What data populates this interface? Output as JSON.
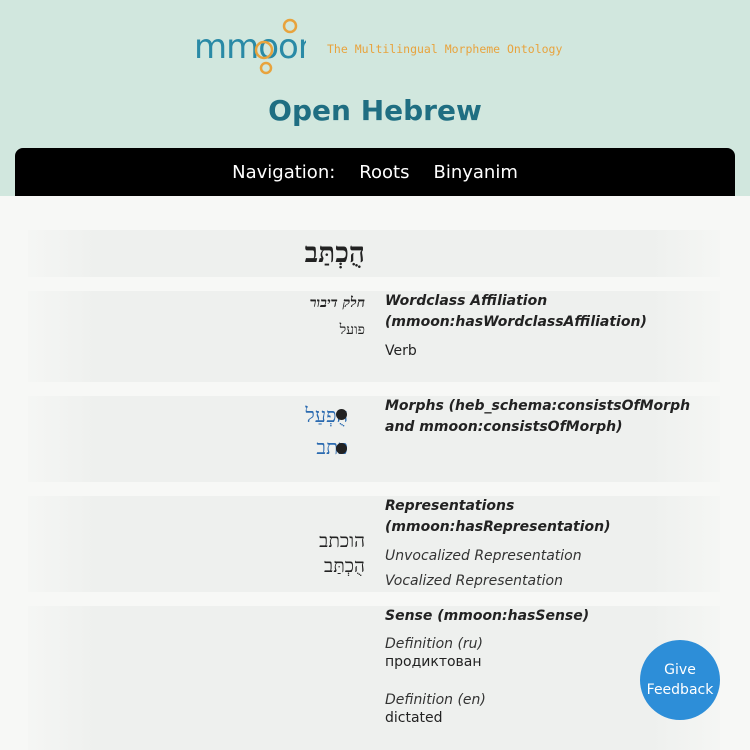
{
  "logo": {
    "text": "mmoon",
    "tagline": "The Multilingual Morpheme Ontology"
  },
  "site": {
    "title": "Open Hebrew"
  },
  "nav": {
    "label": "Navigation:",
    "items": [
      "Roots",
      "Binyanim"
    ]
  },
  "entry": {
    "headword": "הֻכְתַּב",
    "wordclass": {
      "label_he": "חלק דיבור",
      "value_he": "פועל",
      "property": "Wordclass Affiliation (mmoon:hasWordclassAffiliation)",
      "value": "Verb"
    },
    "morphs": {
      "property": "Morphs (heb_schema:consistsOfMorph and mmoon:consistsOfMorph)",
      "items": [
        "הֻפְעַל",
        "כתב"
      ]
    },
    "representations": {
      "property": "Representations (mmoon:hasRepresentation)",
      "unvocalized_label": "Unvocalized Representation",
      "vocalized_label": "Vocalized Representation",
      "unvocalized": "הוכתב",
      "vocalized": "הֻכְתַּב"
    },
    "sense": {
      "property": "Sense (mmoon:hasSense)",
      "def_ru_label": "Definition (ru)",
      "def_ru": "продиктован",
      "def_en_label": "Definition (en)",
      "def_en": "dictated"
    }
  },
  "feedback": {
    "label": "Give Feedback"
  }
}
